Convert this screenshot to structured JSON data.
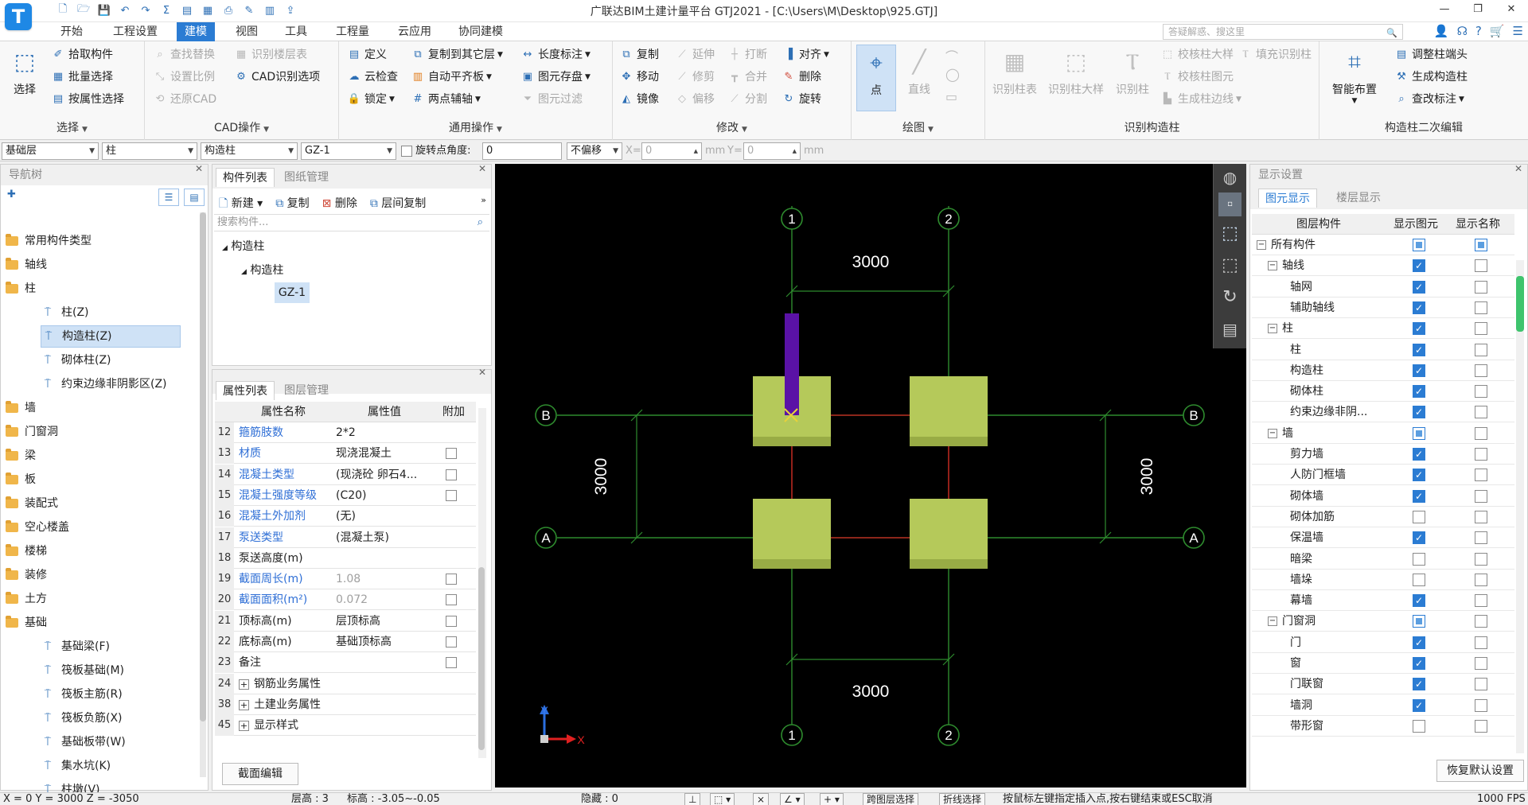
{
  "app": {
    "logo": "T",
    "window_title": "广联达BIM土建计量平台 GTJ2021 - [C:\\Users\\M\\Desktop\\925.GTJ]",
    "quick_access": [
      "new-icon",
      "open-icon",
      "save-icon",
      "undo-icon",
      "redo-icon",
      "sum-icon",
      "report-icon",
      "view-icon",
      "print-icon",
      "pen-icon",
      "grid-icon",
      "export-icon"
    ]
  },
  "menu": {
    "tabs": [
      "开始",
      "工程设置",
      "建模",
      "视图",
      "工具",
      "工程量",
      "云应用",
      "协同建模"
    ],
    "active": "建模",
    "search_placeholder": "答疑解惑、搜这里"
  },
  "ribbon": {
    "select": {
      "big": "选择",
      "items": [
        "拾取构件",
        "批量选择",
        "按属性选择"
      ],
      "label": "选择"
    },
    "cad": {
      "items": [
        "查找替换",
        "设置比例",
        "还原CAD",
        "识别楼层表",
        "CAD识别选项"
      ],
      "label": "CAD操作"
    },
    "common": {
      "items": [
        "定义",
        "云检查",
        "锁定",
        "复制到其它层",
        "自动平齐板",
        "两点辅轴",
        "长度标注",
        "图元存盘",
        "图元过滤"
      ],
      "label": "通用操作"
    },
    "modify": {
      "items": [
        "复制",
        "移动",
        "镜像",
        "延伸",
        "修剪",
        "偏移",
        "打断",
        "合并",
        "分割",
        "对齐",
        "删除",
        "旋转"
      ],
      "label": "修改"
    },
    "draw": {
      "items": [
        "点",
        "直线"
      ],
      "label": "绘图"
    },
    "identify": {
      "items": [
        "识别柱表",
        "识别柱大样",
        "识别柱",
        "校核柱大样",
        "校核柱图元",
        "生成柱边线",
        "填充识别柱"
      ],
      "label": "识别构造柱"
    },
    "secondary": {
      "big": "智能布置",
      "items": [
        "调整柱端头",
        "生成构造柱",
        "查改标注"
      ],
      "label": "构造柱二次编辑"
    }
  },
  "layerbar": {
    "floor": "基础层",
    "category": "柱",
    "type": "构造柱",
    "member": "GZ-1",
    "rotate_label": "旋转点",
    "angle_label": "角度:",
    "angle_value": "0",
    "offset": "不偏移",
    "x_label": "X=",
    "x_value": "0",
    "unit1": "mm",
    "y_label": "Y=",
    "y_value": "0",
    "unit2": "mm"
  },
  "nav": {
    "title": "导航树",
    "items": [
      {
        "label": "常用构件类型",
        "type": "folder"
      },
      {
        "label": "轴线",
        "type": "folder"
      },
      {
        "label": "柱",
        "type": "folder"
      },
      {
        "label": "柱(Z)",
        "type": "sub"
      },
      {
        "label": "构造柱(Z)",
        "type": "sub",
        "selected": true
      },
      {
        "label": "砌体柱(Z)",
        "type": "sub"
      },
      {
        "label": "约束边缘非阴影区(Z)",
        "type": "sub"
      },
      {
        "label": "墙",
        "type": "folder"
      },
      {
        "label": "门窗洞",
        "type": "folder"
      },
      {
        "label": "梁",
        "type": "folder"
      },
      {
        "label": "板",
        "type": "folder"
      },
      {
        "label": "装配式",
        "type": "folder"
      },
      {
        "label": "空心楼盖",
        "type": "folder"
      },
      {
        "label": "楼梯",
        "type": "folder"
      },
      {
        "label": "装修",
        "type": "folder"
      },
      {
        "label": "土方",
        "type": "folder"
      },
      {
        "label": "基础",
        "type": "folder"
      },
      {
        "label": "基础梁(F)",
        "type": "sub"
      },
      {
        "label": "筏板基础(M)",
        "type": "sub"
      },
      {
        "label": "筏板主筋(R)",
        "type": "sub"
      },
      {
        "label": "筏板负筋(X)",
        "type": "sub"
      },
      {
        "label": "基础板带(W)",
        "type": "sub"
      },
      {
        "label": "集水坑(K)",
        "type": "sub"
      },
      {
        "label": "柱墩(V)",
        "type": "sub"
      }
    ]
  },
  "components": {
    "tabs": [
      "构件列表",
      "图纸管理"
    ],
    "toolbar": [
      "新建",
      "复制",
      "删除",
      "层间复制"
    ],
    "search_placeholder": "搜索构件...",
    "tree": [
      "构造柱",
      "构造柱",
      "GZ-1"
    ]
  },
  "properties": {
    "tabs": [
      "属性列表",
      "图层管理"
    ],
    "headers": [
      "属性名称",
      "属性值",
      "附加"
    ],
    "rows": [
      {
        "n": "12",
        "name": "箍筋肢数",
        "value": "2*2",
        "blue": true,
        "chk": false
      },
      {
        "n": "13",
        "name": "材质",
        "value": "现浇混凝土",
        "blue": true,
        "chk": true
      },
      {
        "n": "14",
        "name": "混凝土类型",
        "value": "(现浇砼 卵石4...",
        "blue": true,
        "chk": true
      },
      {
        "n": "15",
        "name": "混凝土强度等级",
        "value": "(C20)",
        "blue": true,
        "chk": true
      },
      {
        "n": "16",
        "name": "混凝土外加剂",
        "value": "(无)",
        "blue": true,
        "chk": false
      },
      {
        "n": "17",
        "name": "泵送类型",
        "value": "(混凝土泵)",
        "blue": true,
        "chk": false
      },
      {
        "n": "18",
        "name": "泵送高度(m)",
        "value": "",
        "blue": false,
        "chk": false
      },
      {
        "n": "19",
        "name": "截面周长(m)",
        "value": "1.08",
        "blue": true,
        "gray": true,
        "chk": true
      },
      {
        "n": "20",
        "name": "截面面积(m²)",
        "value": "0.072",
        "blue": true,
        "gray": true,
        "chk": true
      },
      {
        "n": "21",
        "name": "顶标高(m)",
        "value": "层顶标高",
        "blue": false,
        "chk": true
      },
      {
        "n": "22",
        "name": "底标高(m)",
        "value": "基础顶标高",
        "blue": false,
        "chk": true
      },
      {
        "n": "23",
        "name": "备注",
        "value": "",
        "blue": false,
        "chk": true
      },
      {
        "n": "24",
        "name": "钢筋业务属性",
        "value": "",
        "blue": false,
        "plus": true,
        "chk": false
      },
      {
        "n": "38",
        "name": "土建业务属性",
        "value": "",
        "blue": false,
        "plus": true,
        "chk": false
      },
      {
        "n": "45",
        "name": "显示样式",
        "value": "",
        "blue": false,
        "plus": true,
        "chk": false
      }
    ],
    "section_button": "截面编辑"
  },
  "drawing": {
    "axes_v": [
      "1",
      "2"
    ],
    "axes_h": [
      "A",
      "B"
    ],
    "dim_top": "3000",
    "dim_bottom": "3000",
    "dim_left": "3000",
    "dim_right": "3000",
    "coord_x": "X",
    "coord_y": "Y",
    "colors": {
      "column": "#b5c95a",
      "gz": "#5a12a6",
      "grid": "#2e8b2e",
      "beam": "#b31b1b"
    }
  },
  "display": {
    "title": "显示设置",
    "tabs": [
      "图元显示",
      "楼层显示"
    ],
    "headers": [
      "图层构件",
      "显示图元",
      "显示名称"
    ],
    "rows": [
      {
        "name": "所有构件",
        "level": 0,
        "exp": "−",
        "a": "part",
        "b": "part"
      },
      {
        "name": "轴线",
        "level": 1,
        "exp": "−",
        "a": "on",
        "b": "off"
      },
      {
        "name": "轴网",
        "level": 2,
        "a": "on",
        "b": "off"
      },
      {
        "name": "辅助轴线",
        "level": 2,
        "a": "on",
        "b": "off"
      },
      {
        "name": "柱",
        "level": 1,
        "exp": "−",
        "a": "on",
        "b": "off"
      },
      {
        "name": "柱",
        "level": 2,
        "a": "on",
        "b": "off"
      },
      {
        "name": "构造柱",
        "level": 2,
        "a": "on",
        "b": "off"
      },
      {
        "name": "砌体柱",
        "level": 2,
        "a": "on",
        "b": "off"
      },
      {
        "name": "约束边缘非阴...",
        "level": 2,
        "a": "on",
        "b": "off"
      },
      {
        "name": "墙",
        "level": 1,
        "exp": "−",
        "a": "part",
        "b": "off"
      },
      {
        "name": "剪力墙",
        "level": 2,
        "a": "on",
        "b": "off"
      },
      {
        "name": "人防门框墙",
        "level": 2,
        "a": "on",
        "b": "off"
      },
      {
        "name": "砌体墙",
        "level": 2,
        "a": "on",
        "b": "off"
      },
      {
        "name": "砌体加筋",
        "level": 2,
        "a": "off",
        "b": "off"
      },
      {
        "name": "保温墙",
        "level": 2,
        "a": "on",
        "b": "off"
      },
      {
        "name": "暗梁",
        "level": 2,
        "a": "off",
        "b": "off"
      },
      {
        "name": "墙垛",
        "level": 2,
        "a": "off",
        "b": "off"
      },
      {
        "name": "幕墙",
        "level": 2,
        "a": "on",
        "b": "off"
      },
      {
        "name": "门窗洞",
        "level": 1,
        "exp": "−",
        "a": "part",
        "b": "off"
      },
      {
        "name": "门",
        "level": 2,
        "a": "on",
        "b": "off"
      },
      {
        "name": "窗",
        "level": 2,
        "a": "on",
        "b": "off"
      },
      {
        "name": "门联窗",
        "level": 2,
        "a": "on",
        "b": "off"
      },
      {
        "name": "墙洞",
        "level": 2,
        "a": "on",
        "b": "off"
      },
      {
        "name": "带形窗",
        "level": 2,
        "a": "off",
        "b": "off"
      }
    ],
    "restore_button": "恢复默认设置"
  },
  "status": {
    "coords": "X = 0 Y = 3000 Z = -3050",
    "floor": "层高 : 3",
    "elev": "标高 : -3.05~-0.05",
    "hidden": "隐藏 : 0",
    "btn_layer": "跨图层选择",
    "btn_polyline": "折线选择",
    "hint": "按鼠标左键指定插入点,按右键结束或ESC取消",
    "fps": "1000 FPS"
  }
}
